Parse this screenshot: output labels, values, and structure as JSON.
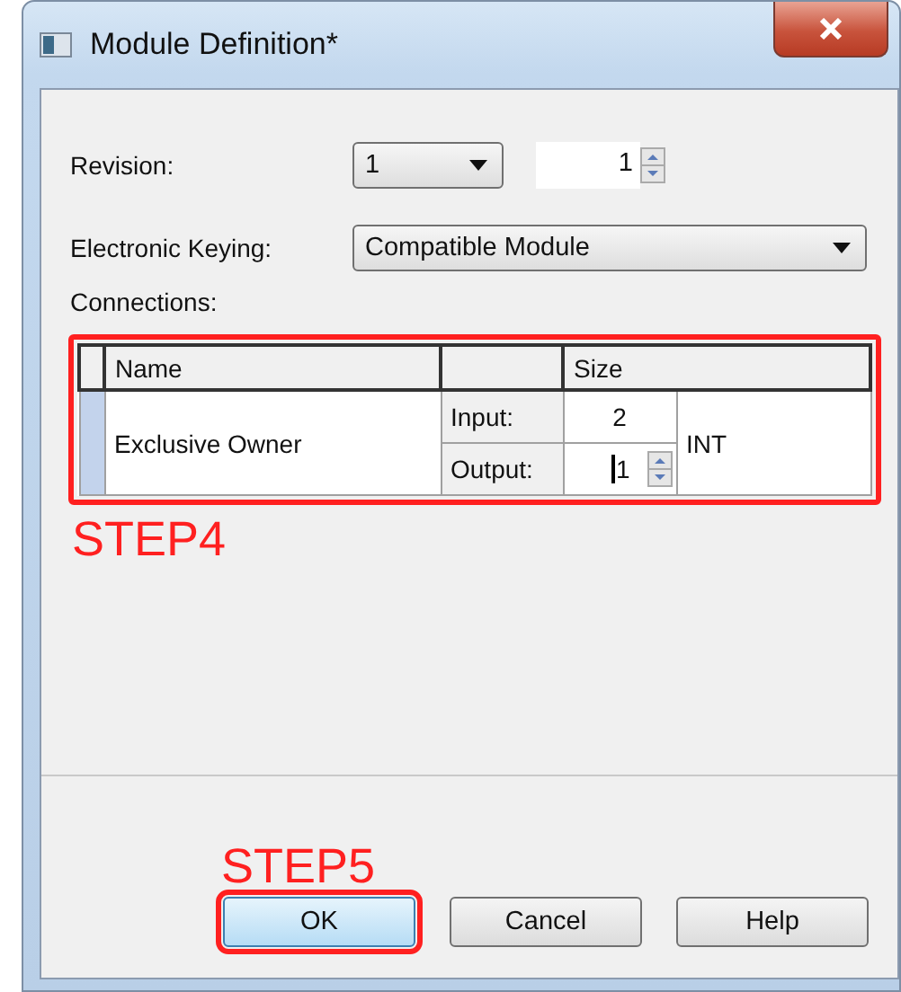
{
  "window": {
    "title": "Module Definition*"
  },
  "revision": {
    "label": "Revision:",
    "major": "1",
    "minor": "1"
  },
  "keying": {
    "label": "Electronic Keying:",
    "value": "Compatible Module"
  },
  "connections": {
    "label": "Connections:",
    "columns": {
      "name": "Name",
      "size": "Size"
    },
    "highlighted": true,
    "rows": [
      {
        "name": "Exclusive Owner",
        "selected": true,
        "input_label": "Input:",
        "input": "2",
        "output_label": "Output:",
        "output": "1",
        "type": "INT"
      }
    ]
  },
  "annotations": [
    {
      "text": "STEP4"
    },
    {
      "text": "STEP5"
    }
  ],
  "buttons": [
    {
      "label": "OK",
      "default": true,
      "highlighted": true
    },
    {
      "label": "Cancel",
      "default": false,
      "highlighted": false
    },
    {
      "label": "Help",
      "default": false,
      "highlighted": false
    }
  ]
}
